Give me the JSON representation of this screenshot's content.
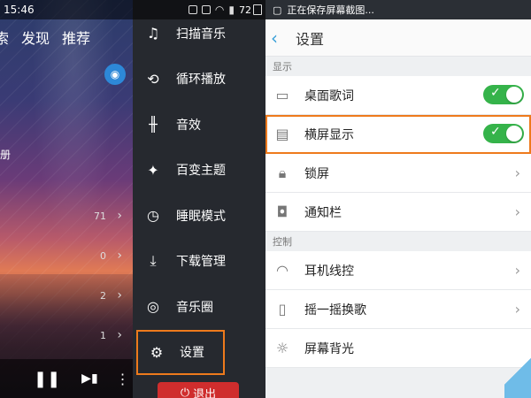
{
  "status_left": {
    "time": "15:46",
    "battery": "72"
  },
  "player": {
    "tabs": [
      "索",
      "发现",
      "推荐"
    ],
    "side_label": "册",
    "counts": [
      {
        "num": "71"
      },
      {
        "num": "0"
      },
      {
        "num": "2"
      },
      {
        "num": "1"
      }
    ]
  },
  "drawer": {
    "items": [
      {
        "label": "扫描音乐",
        "icon": "scan-music-icon"
      },
      {
        "label": "循环播放",
        "icon": "repeat-icon"
      },
      {
        "label": "音效",
        "icon": "equalizer-icon"
      },
      {
        "label": "百变主题",
        "icon": "theme-shirt-icon"
      },
      {
        "label": "睡眠模式",
        "icon": "clock-icon"
      },
      {
        "label": "下载管理",
        "icon": "download-icon"
      },
      {
        "label": "音乐圈",
        "icon": "music-circle-icon"
      },
      {
        "label": "设置",
        "icon": "gear-icon"
      }
    ],
    "exit_label": "退出"
  },
  "status_right": {
    "text": "正在保存屏幕截图..."
  },
  "settings": {
    "title": "设置",
    "sections": [
      {
        "header": "显示",
        "rows": [
          {
            "label": "桌面歌词",
            "type": "toggle",
            "on": true,
            "icon": "lyrics-icon"
          },
          {
            "label": "横屏显示",
            "type": "toggle",
            "on": true,
            "icon": "landscape-icon"
          },
          {
            "label": "锁屏",
            "type": "chevron",
            "icon": "lock-icon"
          },
          {
            "label": "通知栏",
            "type": "chevron",
            "icon": "notification-icon"
          }
        ]
      },
      {
        "header": "控制",
        "rows": [
          {
            "label": "耳机线控",
            "type": "chevron",
            "icon": "headphones-icon"
          },
          {
            "label": "摇一摇换歌",
            "type": "chevron",
            "icon": "shake-icon"
          },
          {
            "label": "屏幕背光",
            "type": "none",
            "icon": "brightness-icon"
          }
        ]
      }
    ]
  },
  "colors": {
    "accent": "#3aa0d8",
    "toggle_on": "#35b34a",
    "highlight": "#ee7a1c",
    "exit": "#cf2d2d"
  }
}
